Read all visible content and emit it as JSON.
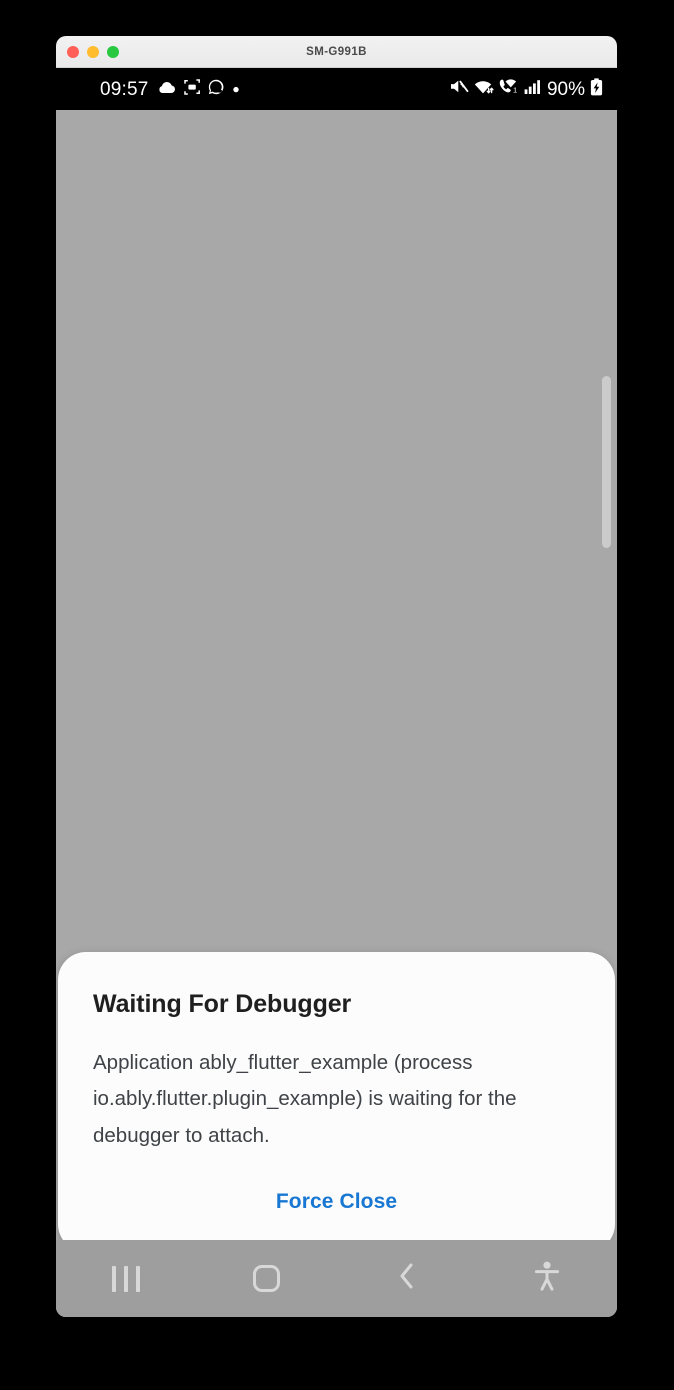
{
  "window": {
    "title": "SM-G991B",
    "traffic_lights": [
      {
        "name": "close",
        "color": "#ff5f57"
      },
      {
        "name": "minimize",
        "color": "#febc2e"
      },
      {
        "name": "maximize",
        "color": "#28c840"
      }
    ]
  },
  "status_bar": {
    "clock": "09:57",
    "battery_percent": "90%",
    "left_icons": [
      "cloud-icon",
      "scan-frame-icon",
      "whatsapp-icon",
      "dot-icon"
    ],
    "right_icons": [
      "mute-icon",
      "wifi-icon",
      "wifi-calling-icon",
      "signal-bars-icon",
      "battery-charging-icon"
    ],
    "background": "#000000",
    "foreground": "#ffffff"
  },
  "content": {
    "background": "#a8a8a8",
    "scrollbar_color": "#cbcbcb"
  },
  "dialog": {
    "title": "Waiting For Debugger",
    "message": "Application ably_flutter_example (process io.ably.flutter.plugin_example) is waiting for the debugger to attach.",
    "action_label": "Force Close",
    "action_color": "#1877d2",
    "background": "#fcfcfc"
  },
  "nav_bar": {
    "background": "#9e9e9e",
    "items": [
      {
        "name": "recents",
        "icon": "recents-icon"
      },
      {
        "name": "home",
        "icon": "home-icon"
      },
      {
        "name": "back",
        "icon": "back-chevron-icon"
      },
      {
        "name": "accessibility",
        "icon": "accessibility-person-icon"
      }
    ]
  }
}
